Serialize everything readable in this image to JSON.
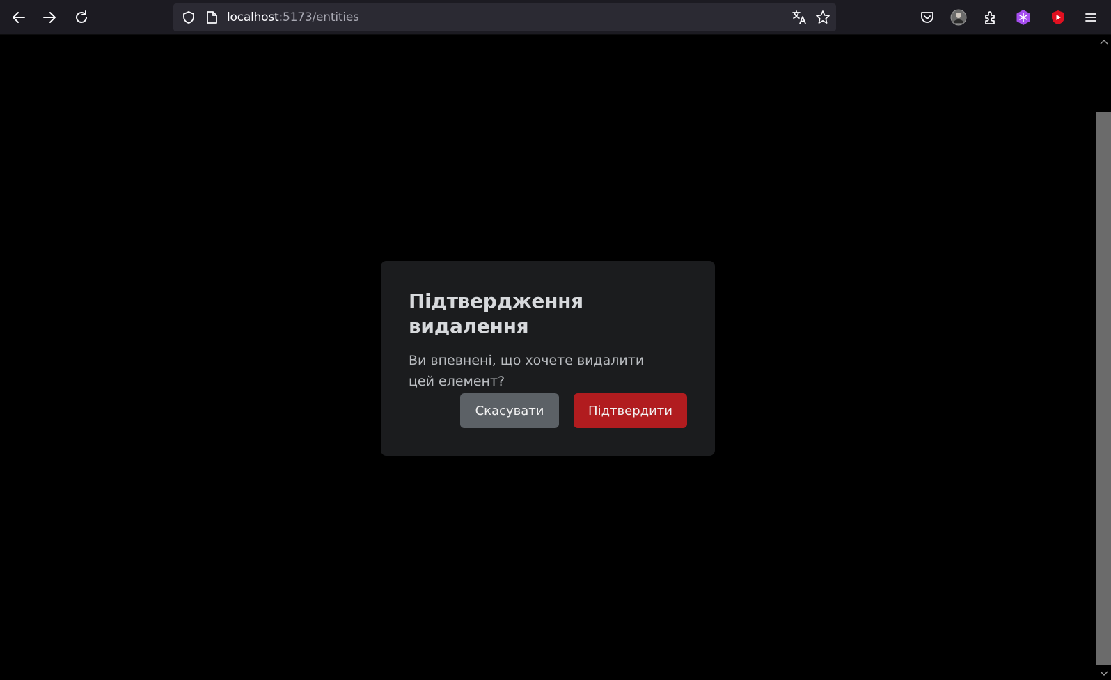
{
  "browser": {
    "url_host": "localhost",
    "url_rest": ":5173/entities",
    "icons": {
      "back": "arrow-left-icon",
      "forward": "arrow-right-icon",
      "reload": "reload-icon",
      "shield": "shield-icon",
      "page": "page-icon",
      "translate": "translate-icon",
      "bookmark": "star-icon",
      "pocket": "pocket-icon",
      "account": "avatar",
      "extensions": "puzzle-icon",
      "ext_purple": "snowflake-extension-icon",
      "ext_youtube": "youtube-extension-icon",
      "menu": "hamburger-menu-icon"
    }
  },
  "dialog": {
    "title": "Підтвердження видалення",
    "message": "Ви впевнені, що хочете видалити цей елемент?",
    "cancel_label": "Скасувати",
    "confirm_label": "Підтвердити"
  },
  "colors": {
    "page_bg": "#000000",
    "modal_bg": "#1b1c1e",
    "cancel_btn": "#5c6166",
    "confirm_btn": "#b11c1f"
  }
}
